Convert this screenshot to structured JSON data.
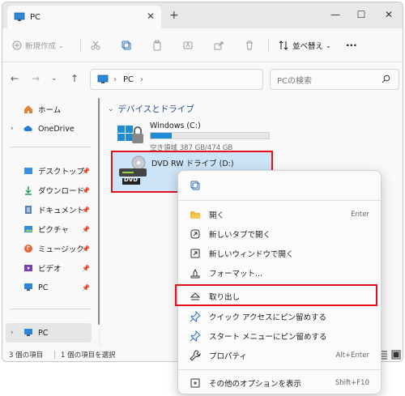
{
  "window": {
    "tab_title": "PC",
    "new_tab": "+",
    "close_tab": "✕",
    "minimize": "—",
    "maximize": "☐",
    "close": "✕"
  },
  "toolbar": {
    "new_label": "新規作成",
    "sort_label": "並べ替え",
    "more": "···"
  },
  "address": {
    "path_label": "PC",
    "separator": "›",
    "search_placeholder": "PCの検索"
  },
  "sidebar": {
    "items": [
      {
        "label": "ホーム",
        "icon": "home-icon"
      },
      {
        "label": "OneDrive",
        "icon": "cloud-icon"
      },
      {
        "label": "デスクトップ",
        "icon": "desktop-icon",
        "pinned": true
      },
      {
        "label": "ダウンロード",
        "icon": "download-icon",
        "pinned": true
      },
      {
        "label": "ドキュメント",
        "icon": "document-icon",
        "pinned": true
      },
      {
        "label": "ピクチャ",
        "icon": "picture-icon",
        "pinned": true
      },
      {
        "label": "ミュージック",
        "icon": "music-icon",
        "pinned": true
      },
      {
        "label": "ビデオ",
        "icon": "video-icon",
        "pinned": true
      },
      {
        "label": "PC",
        "icon": "pc-icon",
        "pinned": true
      },
      {
        "label": "PC",
        "icon": "pc-icon",
        "selected": true
      }
    ]
  },
  "main": {
    "section_title": "デバイスとドライブ",
    "drives": [
      {
        "name": "Windows (C:)",
        "free_text": "空き領域 387 GB/474 GB",
        "used_fraction": 0.18
      },
      {
        "name": "DVD RW ドライブ (D:)",
        "badge": "DVD"
      }
    ]
  },
  "status": {
    "count": "3 個の項目",
    "selected": "1 個の項目を選択"
  },
  "context_menu": {
    "items": [
      {
        "label": "開く",
        "shortcut": "Enter",
        "icon": "folder-open-icon"
      },
      {
        "label": "新しいタブで開く",
        "shortcut": "",
        "icon": "new-tab-icon"
      },
      {
        "label": "新しいウィンドウで開く",
        "shortcut": "",
        "icon": "new-window-icon"
      },
      {
        "label": "フォーマット...",
        "shortcut": "",
        "icon": "format-icon"
      },
      {
        "label": "取り出し",
        "shortcut": "",
        "icon": "eject-icon"
      },
      {
        "label": "クイック アクセスにピン留めする",
        "shortcut": "",
        "icon": "pin-icon"
      },
      {
        "label": "スタート メニューにピン留めする",
        "shortcut": "",
        "icon": "pin-icon"
      },
      {
        "label": "プロパティ",
        "shortcut": "Alt+Enter",
        "icon": "wrench-icon"
      },
      {
        "label": "その他のオプションを表示",
        "shortcut": "Shift+F10",
        "icon": "more-options-icon"
      }
    ]
  },
  "colors": {
    "accent": "#1f8ad6",
    "selection": "#cce4f7",
    "highlight_border": "#e1121a"
  }
}
